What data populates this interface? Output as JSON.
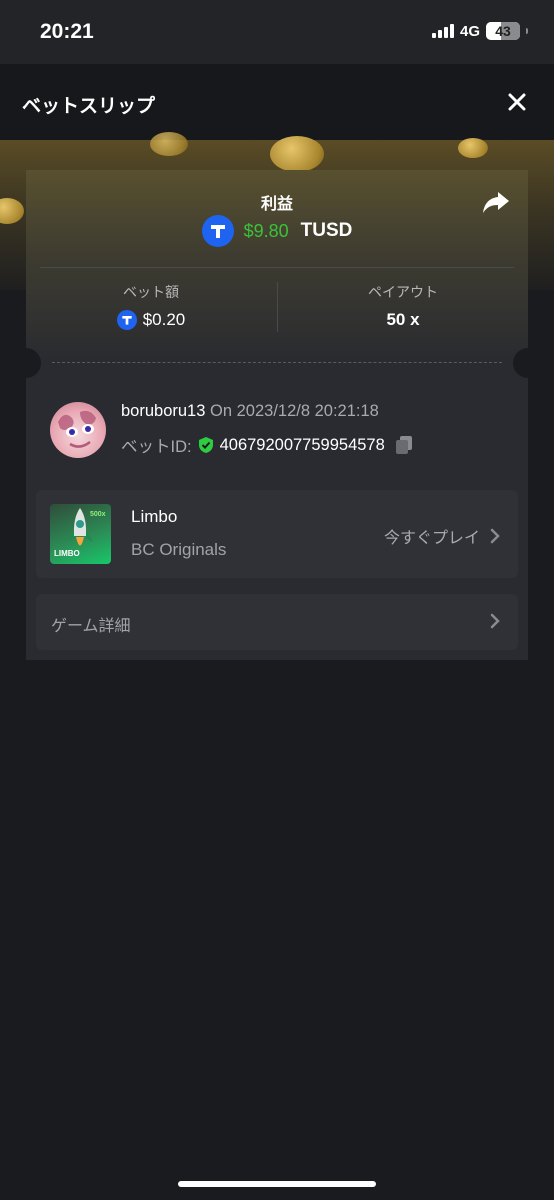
{
  "status_bar": {
    "time": "20:21",
    "network": "4G",
    "battery": "43"
  },
  "header": {
    "title": "ベットスリップ",
    "close_icon": "close-icon"
  },
  "summary": {
    "profit_label": "利益",
    "profit_amount": "$9.80",
    "profit_currency": "TUSD",
    "bet_amount_label": "ベット額",
    "bet_amount": "$0.20",
    "payout_label": "ペイアウト",
    "payout": "50 x"
  },
  "user": {
    "name": "boruboru13",
    "on_label": "On",
    "datetime": "2023/12/8 20:21:18",
    "bet_id_label": "ベットID:",
    "bet_id": "406792007759954578"
  },
  "game": {
    "name": "Limbo",
    "provider": "BC Originals",
    "play_now": "今すぐプレイ",
    "thumb_text": "LIMBO",
    "thumb_multiplier": "500x"
  },
  "details": {
    "label": "ゲーム詳細"
  },
  "colors": {
    "profit": "#3cc23a",
    "tusd": "#1e64f0",
    "verified": "#2ecc40"
  }
}
